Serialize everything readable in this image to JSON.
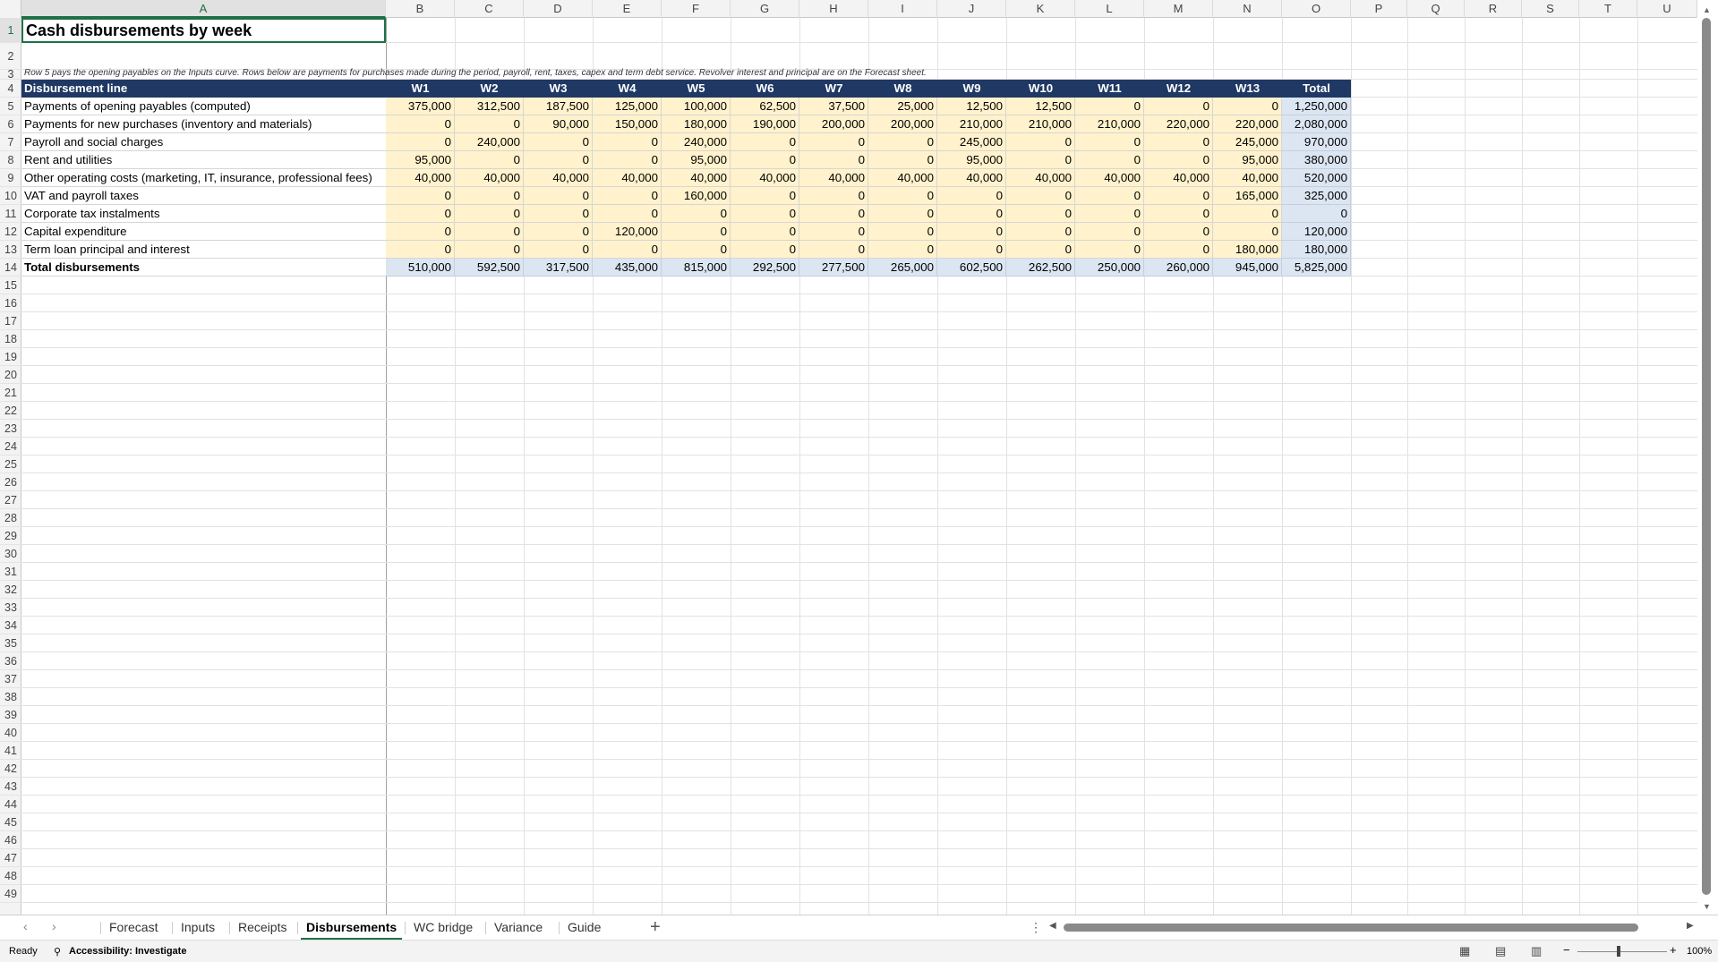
{
  "columns": [
    "A",
    "B",
    "C",
    "D",
    "E",
    "F",
    "G",
    "H",
    "I",
    "J",
    "K",
    "L",
    "M",
    "N",
    "O",
    "P",
    "Q",
    "R",
    "S",
    "T",
    "U"
  ],
  "title": "Cash disbursements by week",
  "note": "Row 5 pays the opening payables on the Inputs curve. Rows below are payments for purchases made during the period, payroll, rent, taxes, capex and term debt service. Revolver interest and principal are on the Forecast sheet.",
  "table": {
    "headers": [
      "Disbursement line",
      "W1",
      "W2",
      "W3",
      "W4",
      "W5",
      "W6",
      "W7",
      "W8",
      "W9",
      "W10",
      "W11",
      "W12",
      "W13",
      "Total"
    ],
    "rows": [
      [
        "Payments of opening payables (computed)",
        "375,000",
        "312,500",
        "187,500",
        "125,000",
        "100,000",
        "62,500",
        "37,500",
        "25,000",
        "12,500",
        "12,500",
        "0",
        "0",
        "0",
        "1,250,000"
      ],
      [
        "Payments for new purchases (inventory and materials)",
        "0",
        "0",
        "90,000",
        "150,000",
        "180,000",
        "190,000",
        "200,000",
        "200,000",
        "210,000",
        "210,000",
        "210,000",
        "220,000",
        "220,000",
        "2,080,000"
      ],
      [
        "Payroll and social charges",
        "0",
        "240,000",
        "0",
        "0",
        "240,000",
        "0",
        "0",
        "0",
        "245,000",
        "0",
        "0",
        "0",
        "245,000",
        "970,000"
      ],
      [
        "Rent and utilities",
        "95,000",
        "0",
        "0",
        "0",
        "95,000",
        "0",
        "0",
        "0",
        "95,000",
        "0",
        "0",
        "0",
        "95,000",
        "380,000"
      ],
      [
        "Other operating costs (marketing, IT, insurance, professional fees)",
        "40,000",
        "40,000",
        "40,000",
        "40,000",
        "40,000",
        "40,000",
        "40,000",
        "40,000",
        "40,000",
        "40,000",
        "40,000",
        "40,000",
        "40,000",
        "520,000"
      ],
      [
        "VAT and payroll taxes",
        "0",
        "0",
        "0",
        "0",
        "160,000",
        "0",
        "0",
        "0",
        "0",
        "0",
        "0",
        "0",
        "165,000",
        "325,000"
      ],
      [
        "Corporate tax instalments",
        "0",
        "0",
        "0",
        "0",
        "0",
        "0",
        "0",
        "0",
        "0",
        "0",
        "0",
        "0",
        "0",
        "0"
      ],
      [
        "Capital expenditure",
        "0",
        "0",
        "0",
        "120,000",
        "0",
        "0",
        "0",
        "0",
        "0",
        "0",
        "0",
        "0",
        "0",
        "120,000"
      ],
      [
        "Term loan principal and interest",
        "0",
        "0",
        "0",
        "0",
        "0",
        "0",
        "0",
        "0",
        "0",
        "0",
        "0",
        "0",
        "180,000",
        "180,000"
      ]
    ],
    "total_row": [
      "Total disbursements",
      "510,000",
      "592,500",
      "317,500",
      "435,000",
      "815,000",
      "292,500",
      "277,500",
      "265,000",
      "602,500",
      "262,500",
      "250,000",
      "260,000",
      "945,000",
      "5,825,000"
    ]
  },
  "tabs": [
    "Forecast",
    "Inputs",
    "Receipts",
    "Disbursements",
    "WC bridge",
    "Variance",
    "Guide"
  ],
  "active_tab": "Disbursements",
  "status": {
    "ready": "Ready",
    "accessibility": "Accessibility: Investigate",
    "zoom": "100%"
  },
  "colors": {
    "header_bg": "#1f3864",
    "input_bg": "#fff2cc",
    "total_bg": "#dce6f2",
    "accent": "#1e7145"
  }
}
